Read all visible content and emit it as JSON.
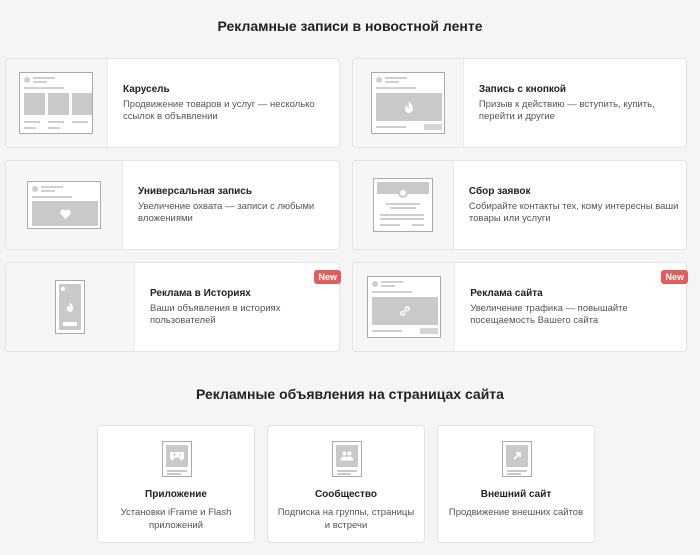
{
  "section1": {
    "title": "Рекламные записи в новостной ленте"
  },
  "formats": [
    {
      "title": "Карусель",
      "desc": "Продвижение товаров и услуг — несколько ссылок в объявлении",
      "icon": "carousel-preview-icon",
      "badge": ""
    },
    {
      "title": "Запись с кнопкой",
      "desc": "Призыв к действию — вступить, купить, перейти и другие",
      "icon": "button-post-preview-icon",
      "badge": ""
    },
    {
      "title": "Универсальная запись",
      "desc": "Увеличение охвата — записи с любыми вложениями",
      "icon": "universal-post-preview-icon",
      "badge": ""
    },
    {
      "title": "Сбор заявок",
      "desc": "Собирайте контакты тех, кому интересны ваши товары или услуги",
      "icon": "lead-form-preview-icon",
      "badge": ""
    },
    {
      "title": "Реклама в Историях",
      "desc": "Ваши объявления в историях пользователей",
      "icon": "stories-preview-icon",
      "badge": "New"
    },
    {
      "title": "Реклама сайта",
      "desc": "Увеличение трафика — повышайте посещаемость Вашего сайта",
      "icon": "site-ad-preview-icon",
      "badge": "New"
    }
  ],
  "section2": {
    "title": "Рекламные объявления на страницах сайта"
  },
  "site_formats": [
    {
      "title": "Приложение",
      "desc": "Установки iFrame и Flash приложений",
      "icon": "gamepad-icon"
    },
    {
      "title": "Сообщество",
      "desc": "Подписка на группы, страницы и встречи",
      "icon": "community-icon"
    },
    {
      "title": "Внешний сайт",
      "desc": "Продвижение внешних сайтов",
      "icon": "external-link-icon"
    }
  ],
  "colors": {
    "badge": "#e35d5d",
    "background": "#f5f5f5",
    "card": "#ffffff"
  }
}
